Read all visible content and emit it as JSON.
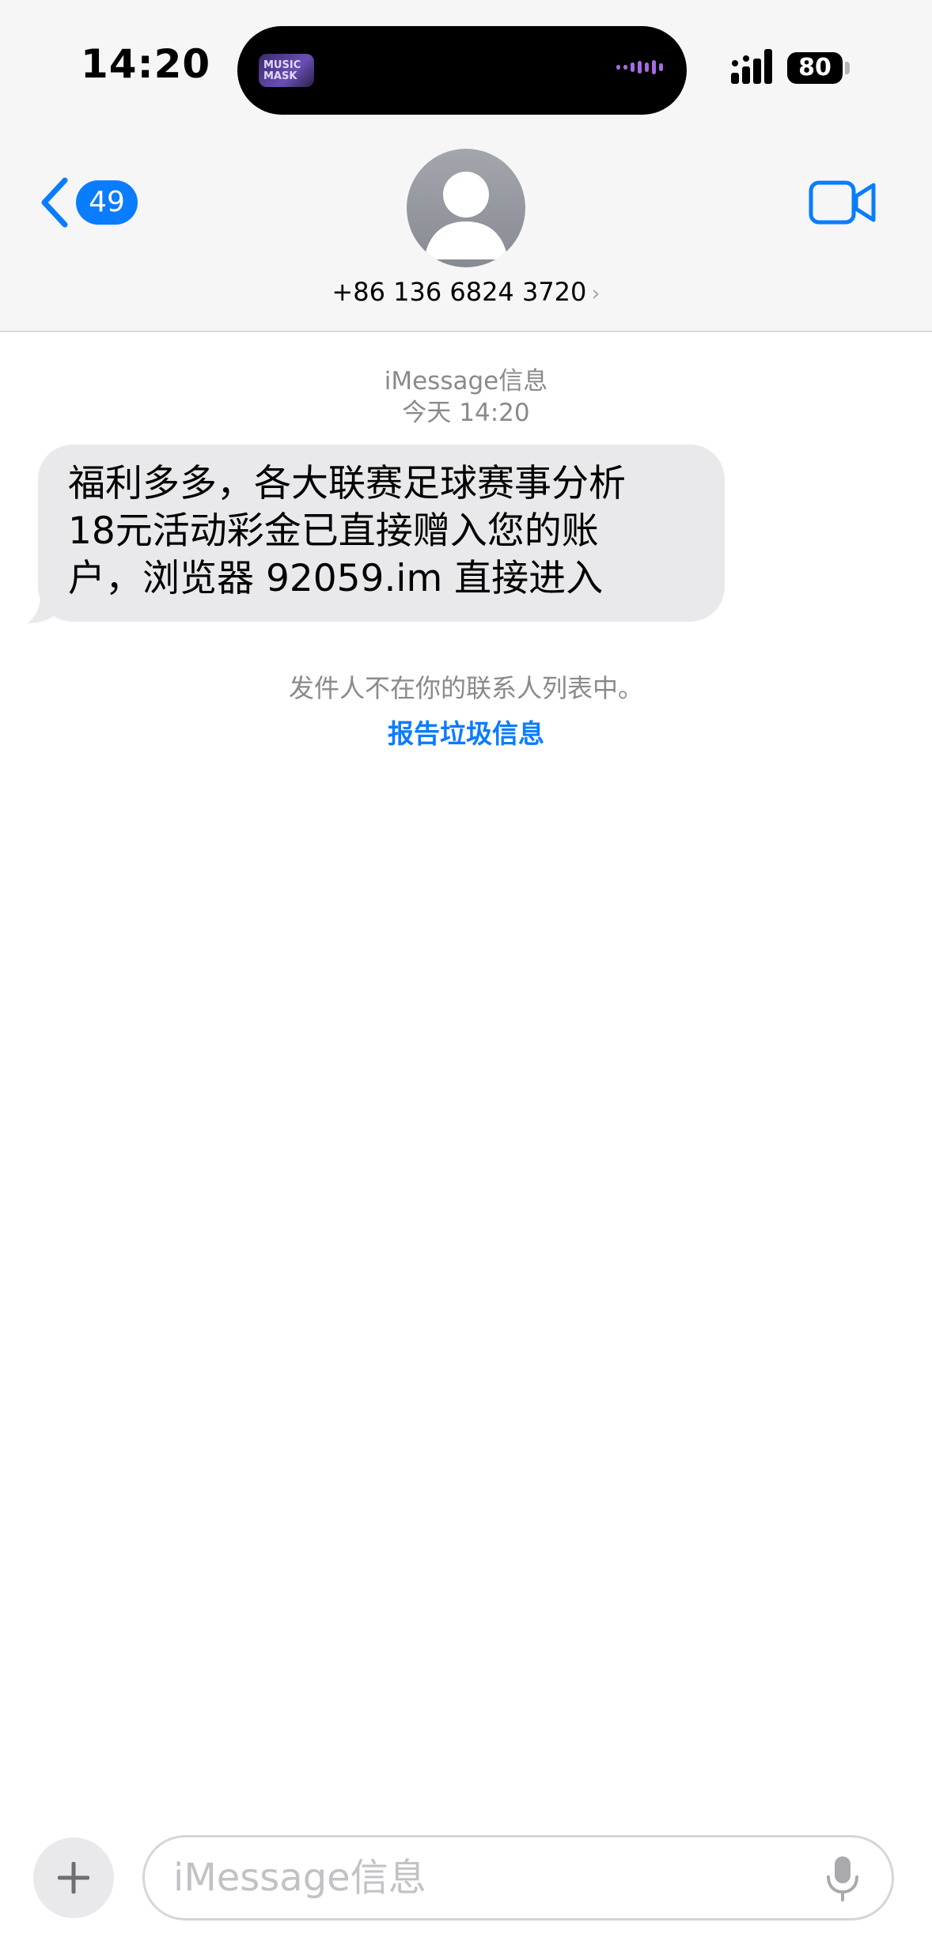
{
  "status_bar": {
    "time": "14:20",
    "battery": "80",
    "island_thumb_text": "MUSIC\nMASK"
  },
  "nav": {
    "back_badge": "49",
    "contact_number": "+86 136 6824 3720",
    "contact_chevron": "›",
    "icons": [
      "back-chevron-icon",
      "person-icon",
      "video-camera-icon"
    ]
  },
  "thread": {
    "service_label": "iMessage信息",
    "timestamp": "今天 14:20",
    "message": "福利多多，各大联赛足球赛事分析\n18元活动彩金已直接赠入您的账\n户，浏览器 92059.im 直接进入",
    "sender_note": "发件人不在你的联系人列表中。",
    "report_link": "报告垃圾信息"
  },
  "composer": {
    "placeholder": "iMessage信息",
    "icons": [
      "plus-icon",
      "microphone-icon"
    ]
  },
  "colors": {
    "accent": "#0a7cff",
    "bubble": "#e9e9eb",
    "header_bg": "#f6f6f6",
    "meta_text": "#8a8a8e"
  }
}
